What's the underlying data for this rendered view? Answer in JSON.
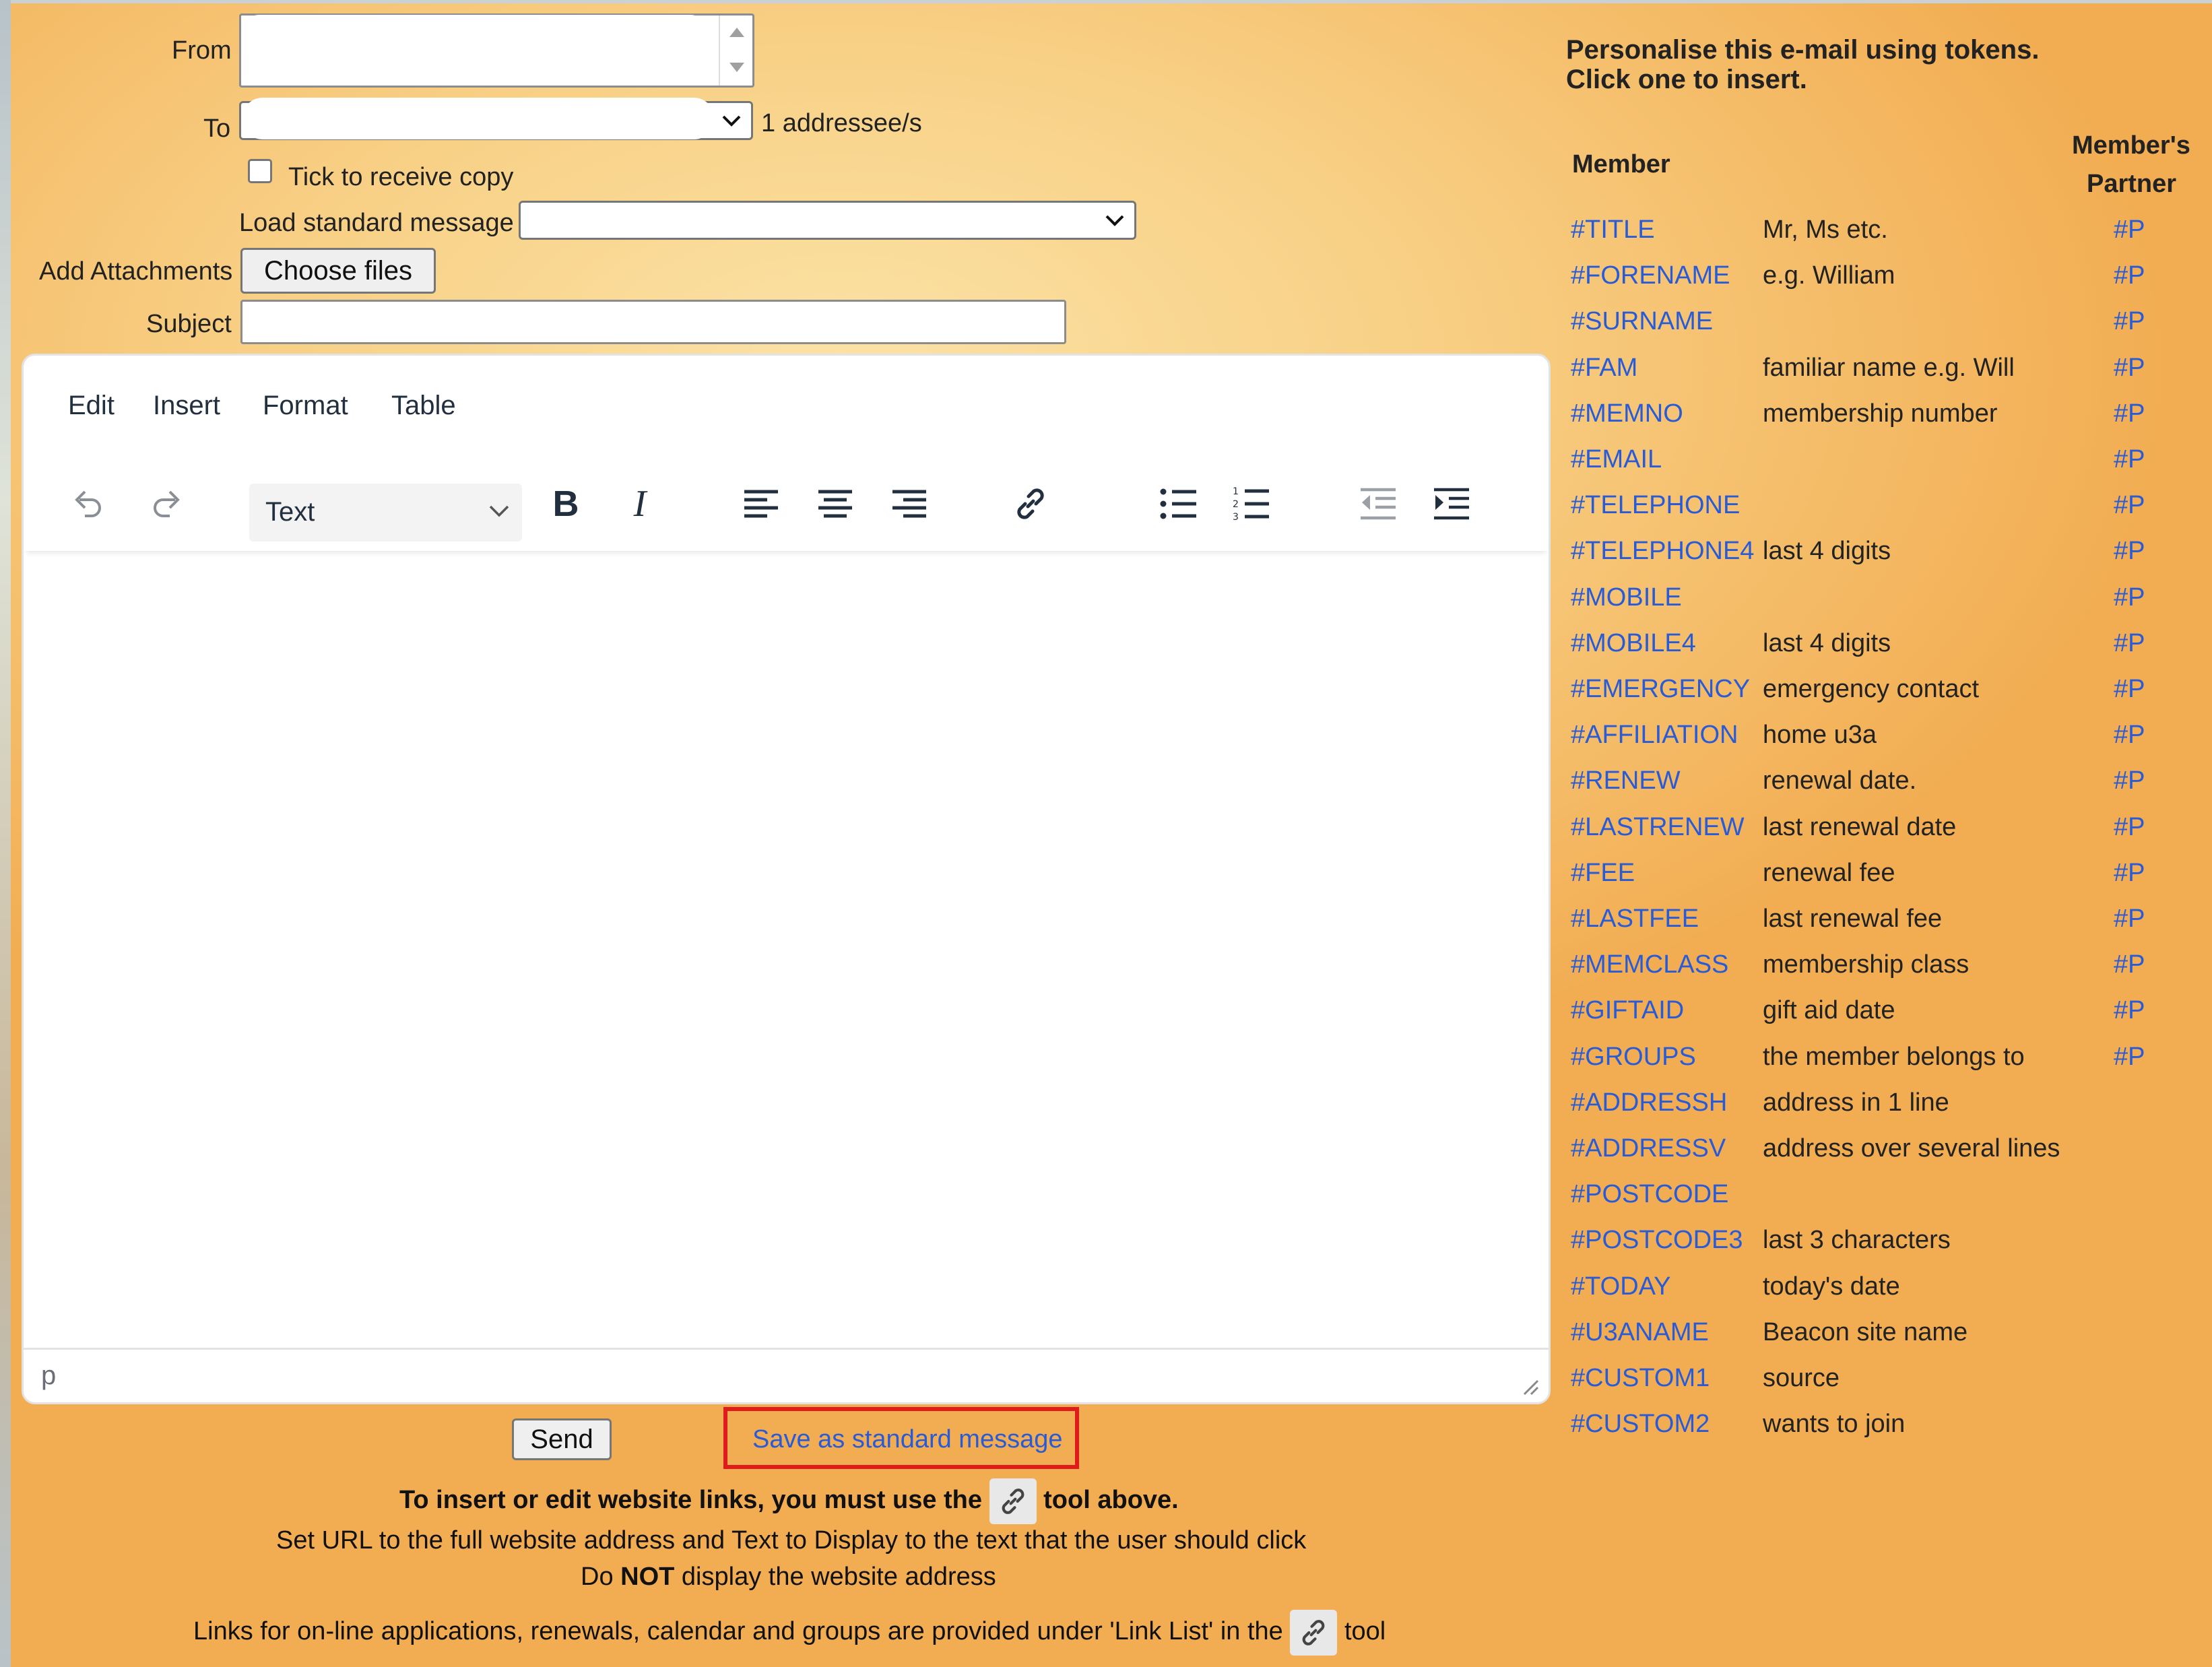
{
  "form": {
    "from_label": "From",
    "to_label": "To",
    "addressee_count": "1 addressee/s",
    "copy_checkbox_label": "Tick to receive copy",
    "standard_message_label": "Load standard message",
    "standard_message_value": "",
    "attachments_label": "Add Attachments",
    "choose_files_label": "Choose files",
    "subject_label": "Subject",
    "subject_value": ""
  },
  "editor": {
    "menu": [
      "Edit",
      "Insert",
      "Format",
      "Table"
    ],
    "block_format": "Text",
    "status_path": "p",
    "toolbar_icons": [
      "undo-icon",
      "redo-icon",
      "bold-icon",
      "italic-icon",
      "align-left-icon",
      "align-center-icon",
      "align-right-icon",
      "link-icon",
      "bullet-list-icon",
      "numbered-list-icon",
      "outdent-icon",
      "indent-icon"
    ]
  },
  "actions": {
    "send_label": "Send",
    "save_standard_label": "Save as standard message",
    "highlight_color": "#e01b1b"
  },
  "notes": {
    "line1_a": "To insert or edit website links, you must use the",
    "line1_b": "tool above.",
    "line2": "Set URL to the full website address and Text to Display to the text that the user should click",
    "line3_a": "Do",
    "line3_b": "NOT",
    "line3_c": "display the website address",
    "line4_a": "Links for on-line applications, renewals, calendar and groups are provided under 'Link List' in the",
    "line4_b": "tool"
  },
  "tokens_panel": {
    "heading_line1": "Personalise this e-mail using tokens.",
    "heading_line2": "Click one to insert.",
    "member_header": "Member",
    "partner_header_line1": "Member's",
    "partner_header_line2": "Partner",
    "token_color": "#2a5bd7",
    "rows": [
      {
        "token": "#TITLE",
        "desc": "Mr, Ms etc.",
        "partner": "#P"
      },
      {
        "token": "#FORENAME",
        "desc": "e.g. William",
        "partner": "#P"
      },
      {
        "token": "#SURNAME",
        "desc": "",
        "partner": "#P"
      },
      {
        "token": "#FAM",
        "desc": "familiar name e.g. Will",
        "partner": "#P"
      },
      {
        "token": "#MEMNO",
        "desc": "membership number",
        "partner": "#P"
      },
      {
        "token": "#EMAIL",
        "desc": "",
        "partner": "#P"
      },
      {
        "token": "#TELEPHONE",
        "desc": "",
        "partner": "#P"
      },
      {
        "token": "#TELEPHONE4",
        "desc": "last 4 digits",
        "partner": "#P"
      },
      {
        "token": "#MOBILE",
        "desc": "",
        "partner": "#P"
      },
      {
        "token": "#MOBILE4",
        "desc": "last 4 digits",
        "partner": "#P"
      },
      {
        "token": "#EMERGENCY",
        "desc": "emergency contact",
        "partner": "#P"
      },
      {
        "token": "#AFFILIATION",
        "desc": "home u3a",
        "partner": "#P"
      },
      {
        "token": "#RENEW",
        "desc": "renewal date.",
        "partner": "#P"
      },
      {
        "token": "#LASTRENEW",
        "desc": "last renewal date",
        "partner": "#P"
      },
      {
        "token": "#FEE",
        "desc": "renewal fee",
        "partner": "#P"
      },
      {
        "token": "#LASTFEE",
        "desc": "last renewal fee",
        "partner": "#P"
      },
      {
        "token": "#MEMCLASS",
        "desc": "membership class",
        "partner": "#P"
      },
      {
        "token": "#GIFTAID",
        "desc": "gift aid date",
        "partner": "#P"
      },
      {
        "token": "#GROUPS",
        "desc": "the member belongs to",
        "partner": "#P"
      },
      {
        "token": "#ADDRESSH",
        "desc": "address in 1 line",
        "partner": ""
      },
      {
        "token": "#ADDRESSV",
        "desc": "address over several lines",
        "partner": ""
      },
      {
        "token": "#POSTCODE",
        "desc": "",
        "partner": ""
      },
      {
        "token": "#POSTCODE3",
        "desc": "last 3 characters",
        "partner": ""
      },
      {
        "token": "#TODAY",
        "desc": "today's date",
        "partner": ""
      },
      {
        "token": "#U3ANAME",
        "desc": "Beacon site name",
        "partner": ""
      },
      {
        "token": "#CUSTOM1",
        "desc": "source",
        "partner": ""
      },
      {
        "token": "#CUSTOM2",
        "desc": "wants to join",
        "partner": ""
      }
    ]
  }
}
